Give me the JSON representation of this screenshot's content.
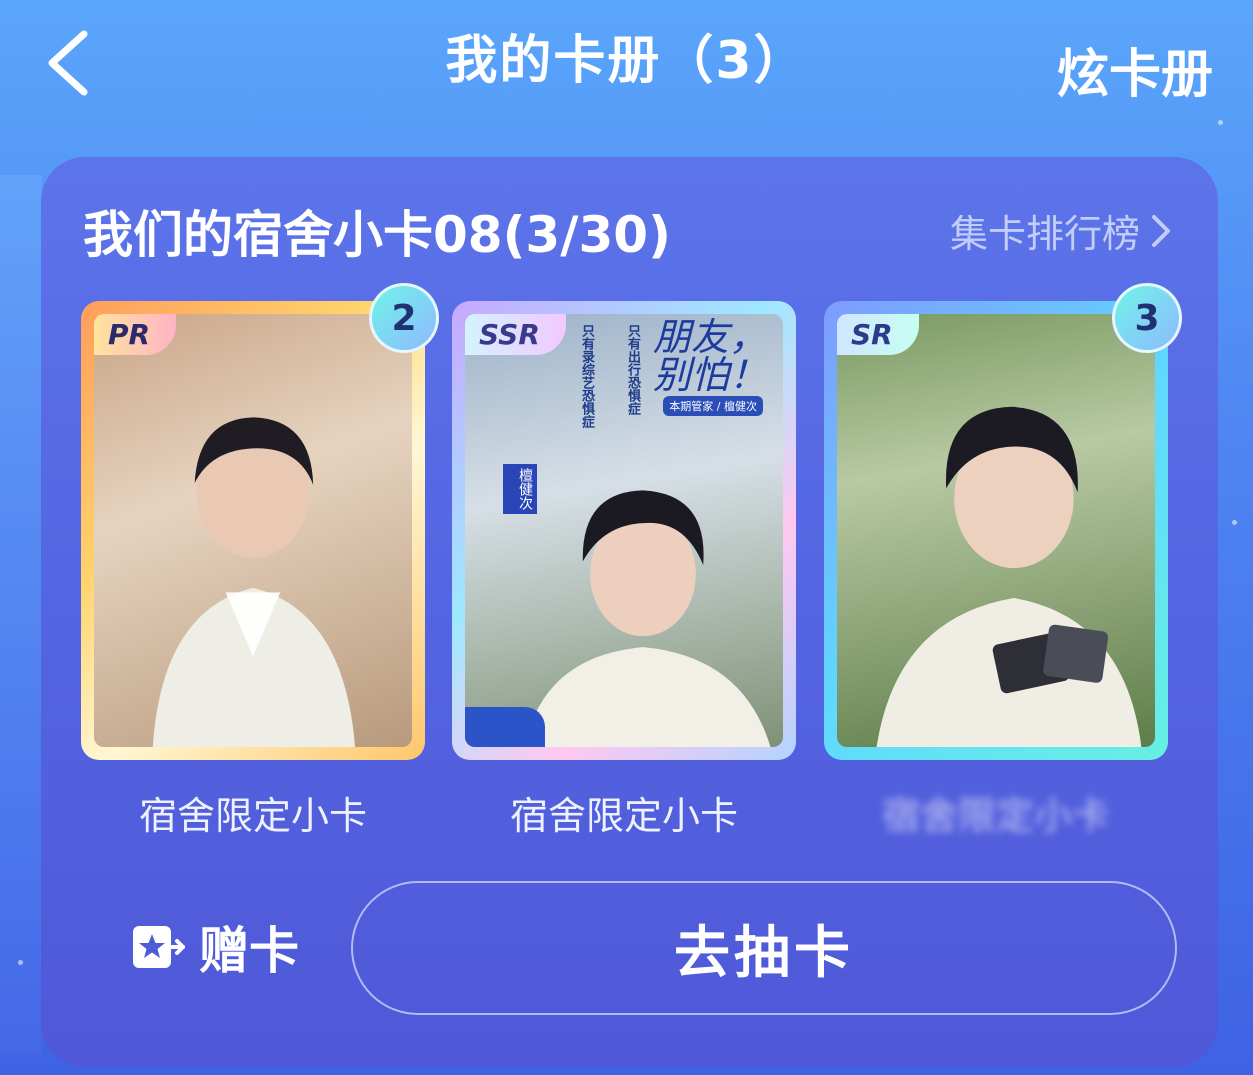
{
  "header": {
    "title": "我的卡册（3）",
    "show_album_label": "炫卡册"
  },
  "album": {
    "title": "我们的宿舍小卡08(3/30)",
    "rank_link_label": "集卡排行榜"
  },
  "cards": [
    {
      "rarity": "PR",
      "count": "2",
      "label": "宿舍限定小卡"
    },
    {
      "rarity": "SSR",
      "count": "",
      "label": "宿舍限定小卡",
      "poster_text": [
        "朋友，",
        "别怕！"
      ],
      "poster_sub": "本期管家 / 檀健次",
      "side_tag": "檀健次",
      "vertical_text_1": "只有录综艺恐惧症",
      "vertical_text_2": "只有出行恐惧症"
    },
    {
      "rarity": "SR",
      "count": "3",
      "label": "宿舍限定小卡"
    }
  ],
  "actions": {
    "gift_label": "赠卡",
    "draw_label": "去抽卡"
  },
  "colors": {
    "accent_teal": "#6ff3e8",
    "panel": "#5566e2"
  }
}
